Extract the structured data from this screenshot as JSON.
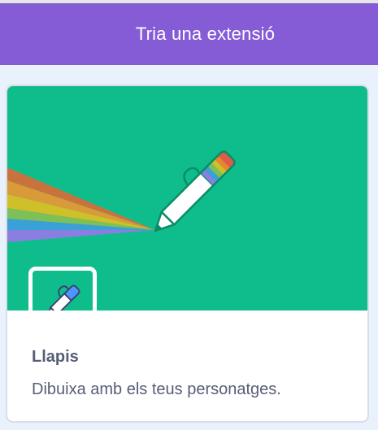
{
  "header": {
    "title": "Tria una extensió"
  },
  "extension_card": {
    "name": "Llapis",
    "description": "Dibuixa amb els teus personatges."
  },
  "colors": {
    "header_bg": "#855cd6",
    "banner_bg": "#0fbd8c",
    "text": "#575e75",
    "page_bg": "#e9f1fc"
  },
  "icons": {
    "banner": "pen-rainbow-icon",
    "extension": "pen-icon"
  }
}
